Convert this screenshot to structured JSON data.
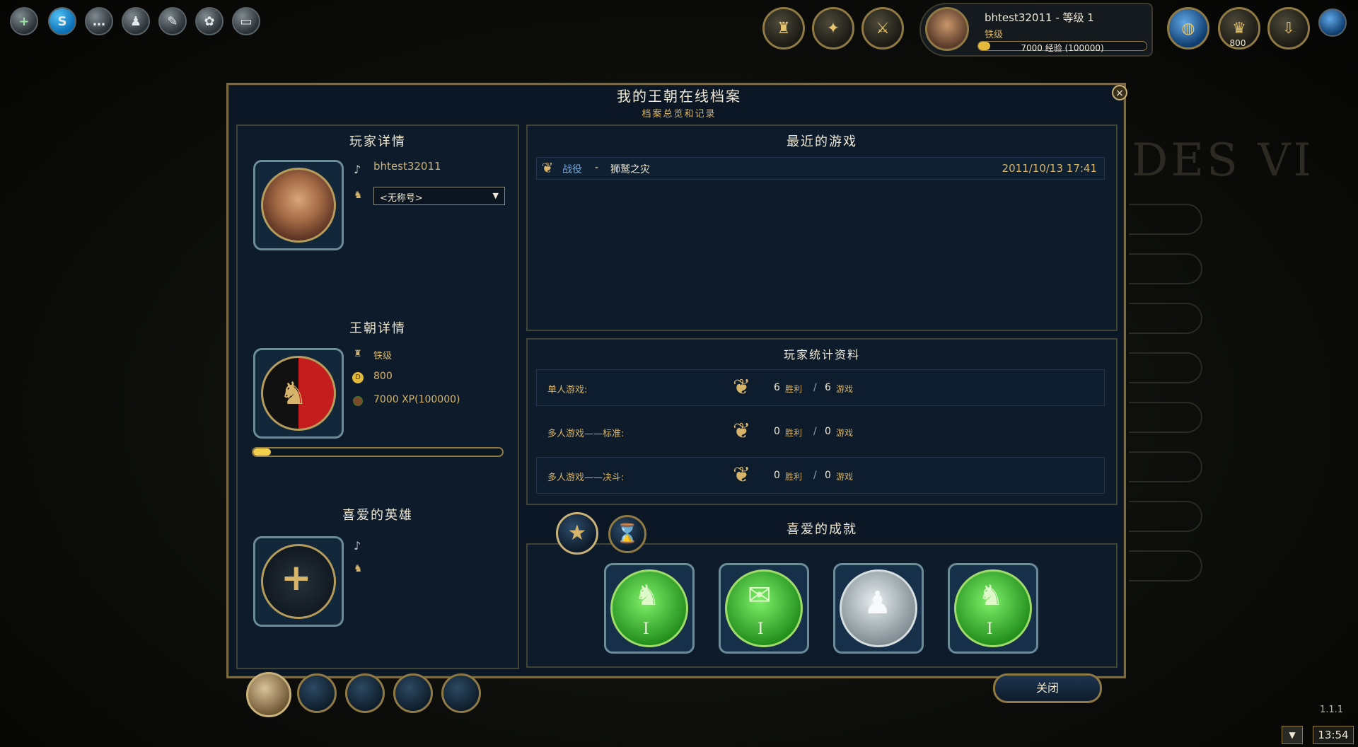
{
  "hud": {
    "player_line": "bhtest32011 - 等级 1",
    "rank": "铁级",
    "xp_text": "7000 经验 (100000)",
    "xp_progress": 0.07,
    "gold": "800"
  },
  "dialog": {
    "title": "我的王朝在线档案",
    "subtitle": "档案总览和记录",
    "close_label": "关闭"
  },
  "player_details": {
    "heading": "玩家详情",
    "name": "bhtest32011",
    "title_select": "<无称号>"
  },
  "dynasty_details": {
    "heading": "王朝详情",
    "rank": "铁级",
    "gold": "800",
    "xp": "7000 XP(100000)",
    "xp_progress": 0.07
  },
  "favorite_hero": {
    "heading": "喜爱的英雄"
  },
  "recent_games": {
    "heading": "最近的游戏",
    "items": [
      {
        "mode": "战役",
        "separator": "-",
        "name": "狮鹫之灾",
        "date": "2011/10/13 17:41"
      }
    ]
  },
  "player_stats": {
    "heading": "玩家统计资料",
    "rows": [
      {
        "label": "单人游戏:",
        "wins": "6",
        "wins_label": "胜利",
        "sep": "/",
        "games": "6",
        "games_label": "游戏"
      },
      {
        "label": "多人游戏——标准:",
        "wins": "0",
        "wins_label": "胜利",
        "sep": "/",
        "games": "0",
        "games_label": "游戏"
      },
      {
        "label": "多人游戏——决斗:",
        "wins": "0",
        "wins_label": "胜利",
        "sep": "/",
        "games": "0",
        "games_label": "游戏"
      }
    ]
  },
  "achievements": {
    "heading": "喜爱的成就",
    "items": [
      {
        "icon": "hero-achievement-icon",
        "numeral": "I"
      },
      {
        "icon": "scroll-achievement-icon",
        "numeral": "I"
      },
      {
        "icon": "pawn-achievement-icon",
        "numeral": ""
      },
      {
        "icon": "hero-achievement-icon",
        "numeral": "I"
      }
    ]
  },
  "footer": {
    "version": "1.1.1",
    "clock": "13:54"
  },
  "colors": {
    "panel_bg": "#0d1b2a",
    "border_gold": "#7b6a3f",
    "text_gold": "#d6b46a",
    "achievement_green": "#3fbf3a"
  }
}
